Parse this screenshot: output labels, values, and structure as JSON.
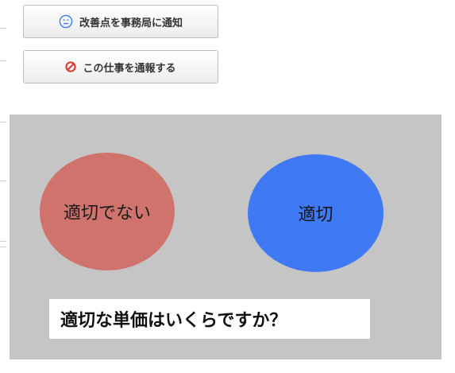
{
  "actions": {
    "notify_label": "改善点を事務局に通知",
    "report_label": "この仕事を通報する"
  },
  "choices": {
    "inappropriate_label": "適切でない",
    "appropriate_label": "適切"
  },
  "question": {
    "text": "適切な単価はいくらですか？"
  },
  "icons": {
    "notify": "neutral-face-icon",
    "report": "prohibited-icon"
  },
  "colors": {
    "panel_background": "#c5c5c5",
    "inappropriate": "#d0736c",
    "appropriate": "#3f7af4",
    "notify_icon": "#3f7af4",
    "report_icon": "#d9342b"
  }
}
